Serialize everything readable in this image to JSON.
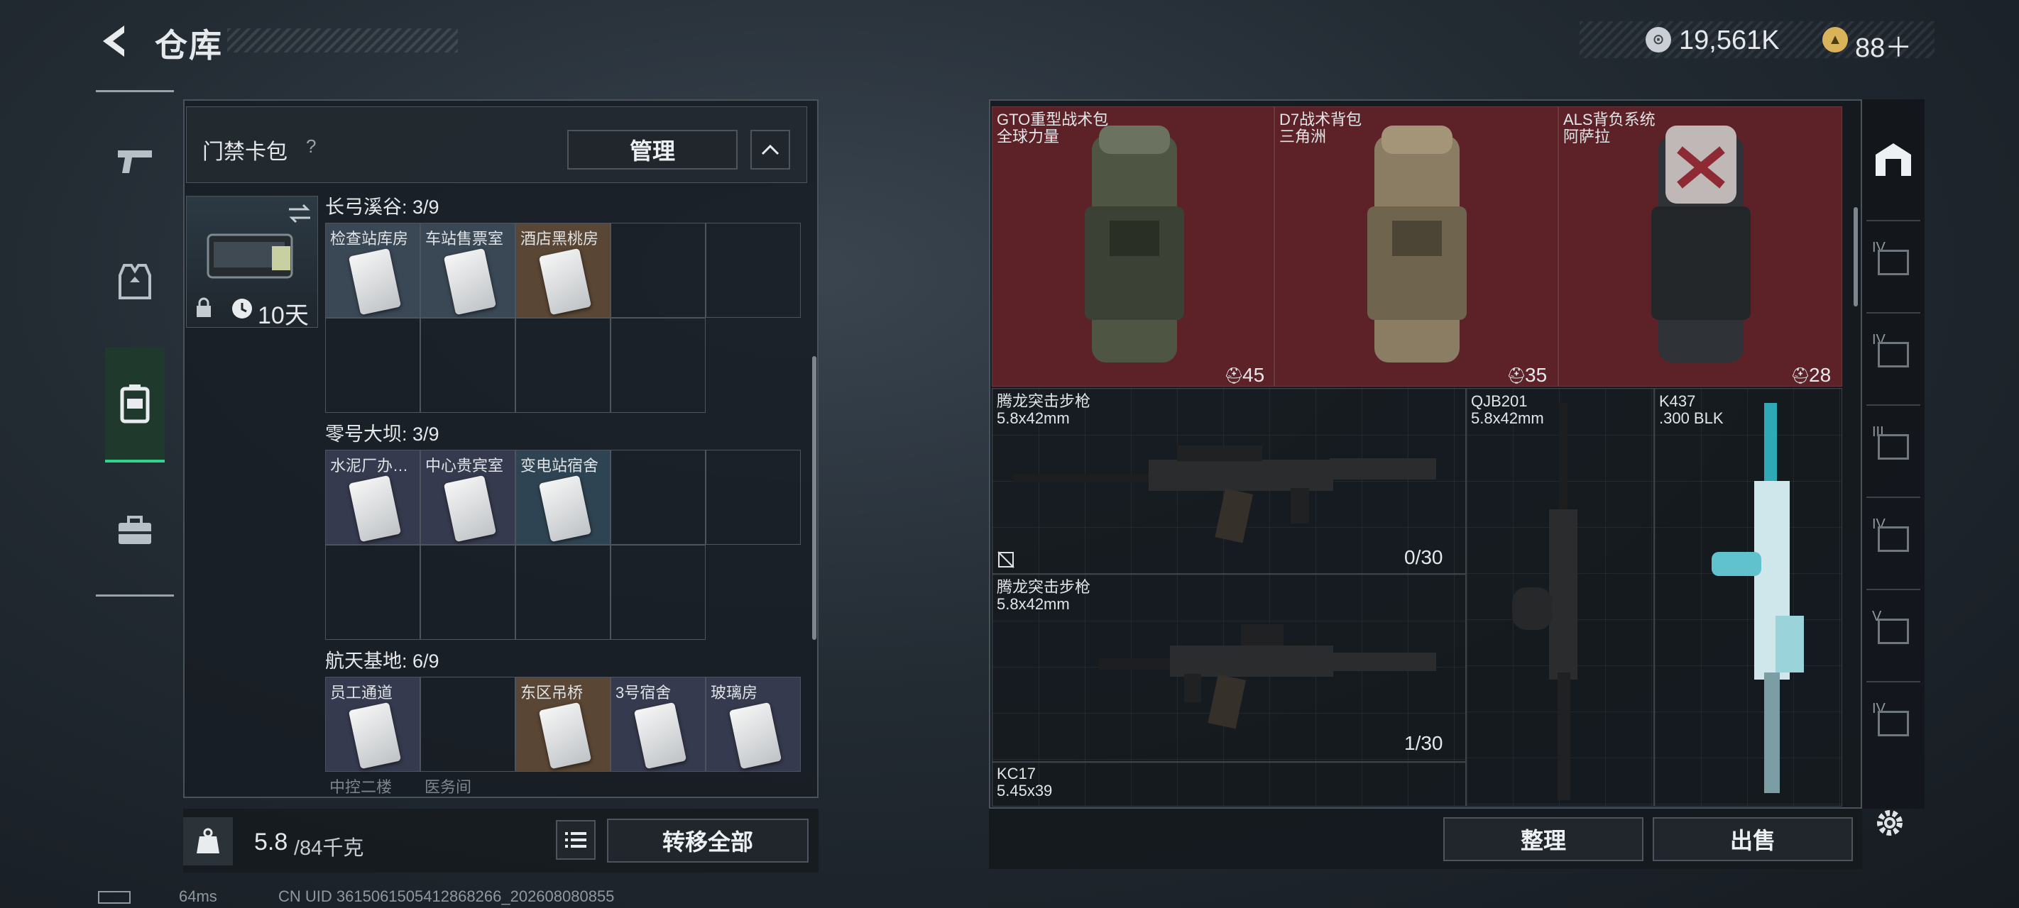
{
  "header": {
    "title": "仓库",
    "currency_value": "19,561K",
    "tickets_value": "88＋"
  },
  "nav": {
    "items": [
      {
        "icon": "pistol-icon"
      },
      {
        "icon": "vest-icon"
      },
      {
        "icon": "backpack-icon",
        "active": true
      },
      {
        "icon": "toolbox-icon"
      }
    ]
  },
  "keycard_pack": {
    "label": "门禁卡包",
    "help": "?",
    "manage": "管理",
    "duration": "10天",
    "groups": [
      {
        "title": "长弓溪谷: 3/9",
        "cards": [
          "检查站库房",
          "车站售票室",
          "酒店黑桃房"
        ]
      },
      {
        "title": "零号大坝: 3/9",
        "cards": [
          "水泥厂办…",
          "中心贵宾室",
          "变电站宿舍"
        ]
      },
      {
        "title": "航天基地: 6/9",
        "cards": [
          "员工通道",
          "",
          "东区吊桥",
          "3号宿舍",
          "玻璃房"
        ],
        "below": [
          "中控二楼",
          "医务间"
        ]
      }
    ]
  },
  "bottom_bar": {
    "weight": "5.8",
    "weight_unit": "/84千克",
    "transfer_all": "转移全部"
  },
  "inventory": {
    "backpacks": [
      {
        "name": "GTO重型战术包",
        "brand": "全球力量",
        "count": "45",
        "bg": "#5c2228"
      },
      {
        "name": "D7战术背包",
        "brand": "三角洲",
        "count": "35",
        "bg": "#5c2228"
      },
      {
        "name": "ALS背负系统",
        "brand": "阿萨拉",
        "count": "28",
        "bg": "#5c2228"
      }
    ],
    "guns": [
      {
        "name": "腾龙突击步枪",
        "caliber": "5.8x42mm",
        "ammo": "0/30"
      },
      {
        "name": "腾龙突击步枪",
        "caliber": "5.8x42mm",
        "ammo": "1/30"
      },
      {
        "name": "QJB201",
        "caliber": "5.8x42mm"
      },
      {
        "name": "K437",
        "caliber": ".300 BLK"
      },
      {
        "name": "KC17",
        "caliber": "5.45x39"
      }
    ],
    "sort": "整理",
    "sell": "出售"
  },
  "right_strip": {
    "tiers": [
      "IV",
      "IV",
      "III",
      "IV",
      "V",
      "IV"
    ]
  },
  "footer": {
    "ping": "64ms",
    "uid": "CN UID 3615061505412868266_202608080855"
  },
  "colors": {
    "accent_green": "#31d48b",
    "backpack_bg": "#5c2228"
  }
}
